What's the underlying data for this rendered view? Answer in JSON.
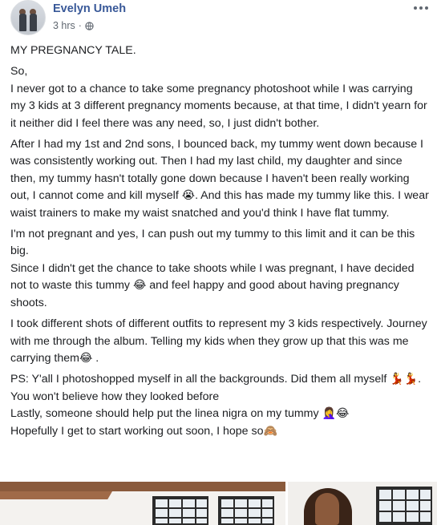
{
  "post": {
    "author": "Evelyn Umeh",
    "timestamp": "3 hrs",
    "separator": "·",
    "privacy_icon": "globe-icon",
    "more_icon": "more-options-icon"
  },
  "body": {
    "title": "MY PREGNANCY TALE.",
    "p1_line1": "So,",
    "p1_line2": "I never got to a chance to take some pregnancy photoshoot while I was carrying my 3 kids at 3 different pregnancy moments because, at that time, I didn't yearn for it neither did I feel there was any need, so, I just didn't bother.",
    "p2_text": "After I had my 1st and 2nd sons, I bounced back, my tummy went down because I was consistently working out. Then I had my last child, my daughter and since then, my tummy hasn't totally gone down because I haven't been really working out, I cannot come and kill myself",
    "p2_emoji": "😭",
    "p2_text_after": ". And this has made my tummy like this. I wear waist trainers to make my waist snatched and you'd think I have flat tummy.",
    "p3_line1": "I'm not pregnant and yes, I can push out my tummy to this limit and it can be this big.",
    "p3_line2_before": "Since I didn't get the chance to take shoots while I was pregnant, I have decided not to waste this tummy",
    "p3_emoji": "😂",
    "p3_line2_after": "and feel happy and good about having pregnancy shoots.",
    "p4_text": "I took different shots of different outfits to represent my 3 kids respectively. Journey with me through the album. Telling my kids when they grow up that this was me carrying them",
    "p4_emoji": "😂",
    "p4_after": ".",
    "p5_line1": "PS: Y'all I photoshopped myself in all the backgrounds. Did them all myself",
    "p5_emoji1": "💃💃",
    "p5_line1_after": ". You won't believe how they looked before",
    "p5_line2": "Lastly, someone should help put the linea nigra on my tummy",
    "p5_emoji2": "🤦‍♀️😂",
    "p5_line3": "Hopefully I get to start working out soon, I hope so",
    "p5_emoji3": "🙈"
  },
  "colors": {
    "author_link": "#385898",
    "meta_text": "#606770",
    "body_text": "#1c1e21"
  }
}
